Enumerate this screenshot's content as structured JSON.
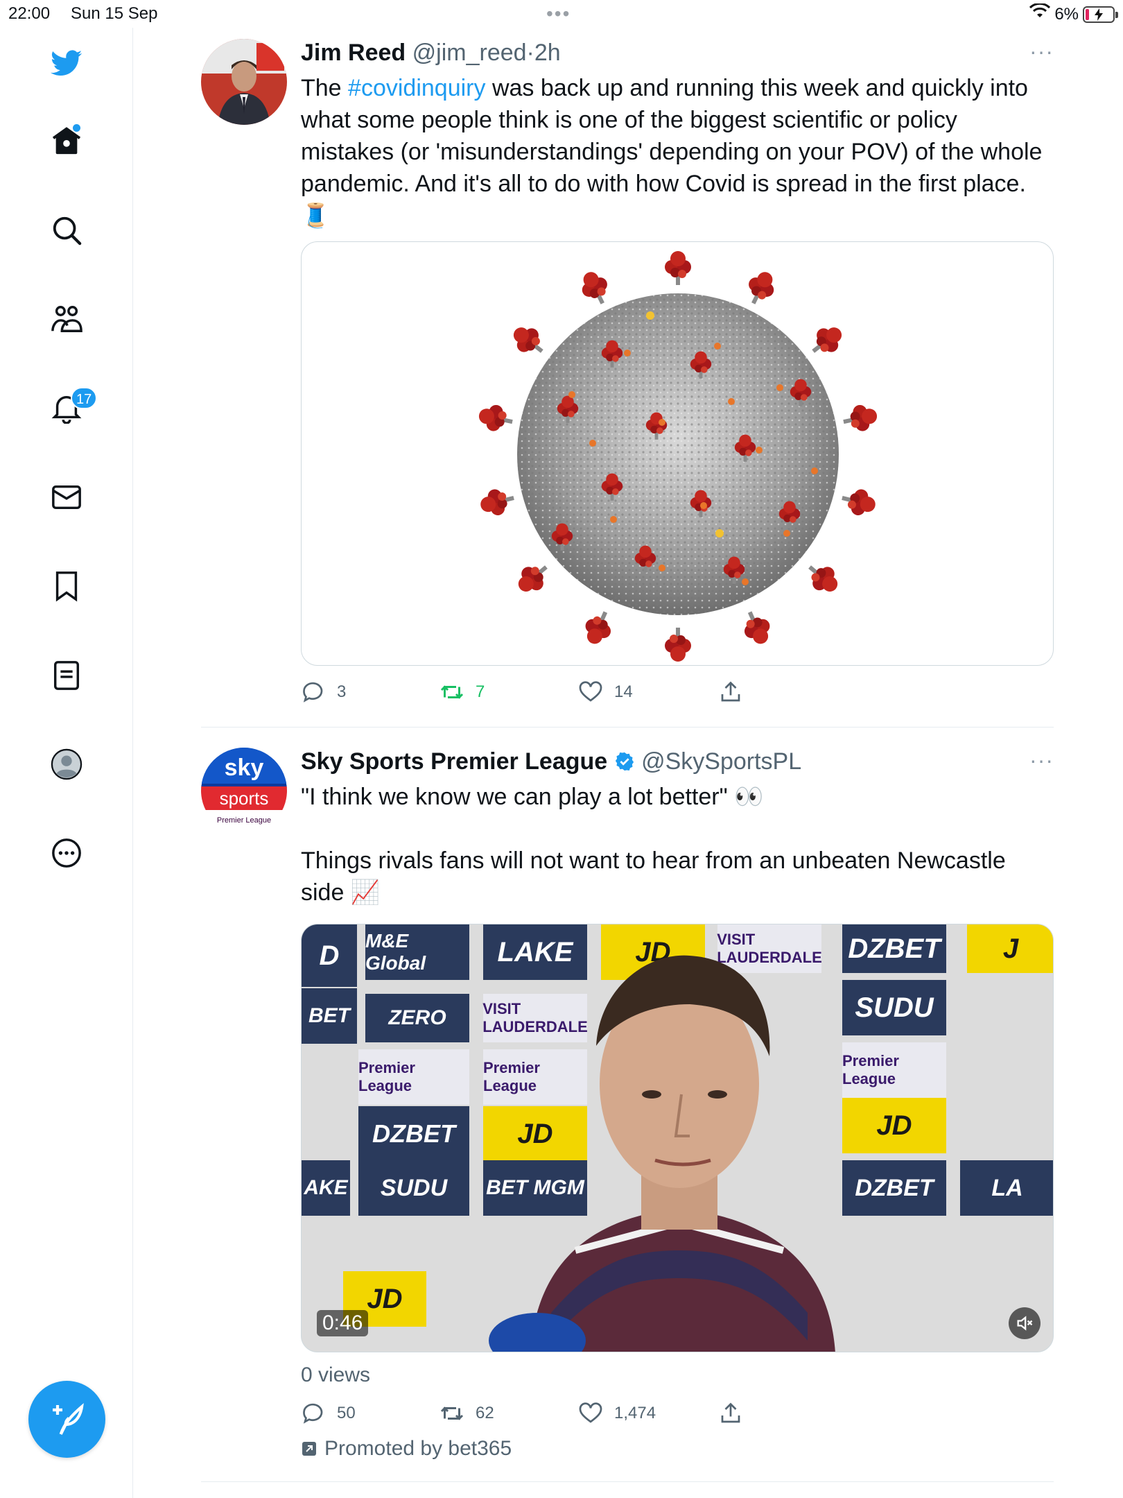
{
  "status_bar": {
    "time": "22:00",
    "date": "Sun 15 Sep",
    "battery_percent": "6%",
    "wifi_icon": "wifi-icon",
    "battery_icon": "battery-charging-icon"
  },
  "sidebar": {
    "items": [
      {
        "name": "twitter-logo-icon"
      },
      {
        "name": "home-icon"
      },
      {
        "name": "search-icon"
      },
      {
        "name": "communities-icon"
      },
      {
        "name": "notifications-icon"
      },
      {
        "name": "messages-icon"
      },
      {
        "name": "bookmarks-icon"
      },
      {
        "name": "lists-icon"
      },
      {
        "name": "profile-icon"
      },
      {
        "name": "more-icon"
      }
    ],
    "notification_count": "17",
    "compose_icon": "compose-tweet-icon"
  },
  "tweets": [
    {
      "author": "Jim Reed",
      "handle": "@jim_reed",
      "separator": "·",
      "time": "2h",
      "more": "···",
      "text_prefix": "The ",
      "hashtag": "#covidinquiry",
      "text_rest": " was back up and running this week and quickly into what some people think is one of the biggest scientific or policy mistakes (or 'misunderstandings' depending on your POV) of the whole pandemic. And it's all to do with how Covid is spread in the first place.",
      "emoji": "🧵",
      "replies": "3",
      "retweets": "7",
      "likes": "14"
    },
    {
      "author": "Sky Sports Premier League",
      "handle": "@SkySportsPL",
      "more": "···",
      "verified": true,
      "line1": "\"I think we know we can play a lot better\" 👀",
      "line2": "Things rivals fans will not want to hear from an unbeaten Newcastle side 📈",
      "video_time": "0:46",
      "views": "0 views",
      "replies": "50",
      "retweets": "62",
      "likes": "1,474",
      "promoted": "Promoted by bet365",
      "avatar_text_top": "sky",
      "avatar_text_mid": "sports",
      "avatar_text_bottom": "Premier League",
      "ad_boards": [
        "M&E Global",
        "LAKE",
        "JD",
        "DZBET",
        "ZERO",
        "SUDU",
        "BET MGM",
        "Premier League",
        "VISIT LAUDERDALE"
      ]
    }
  ],
  "colors": {
    "accent": "#1d9bf0",
    "retweet_green": "#17bf63",
    "text": "#0f1419",
    "muted": "#536471"
  }
}
